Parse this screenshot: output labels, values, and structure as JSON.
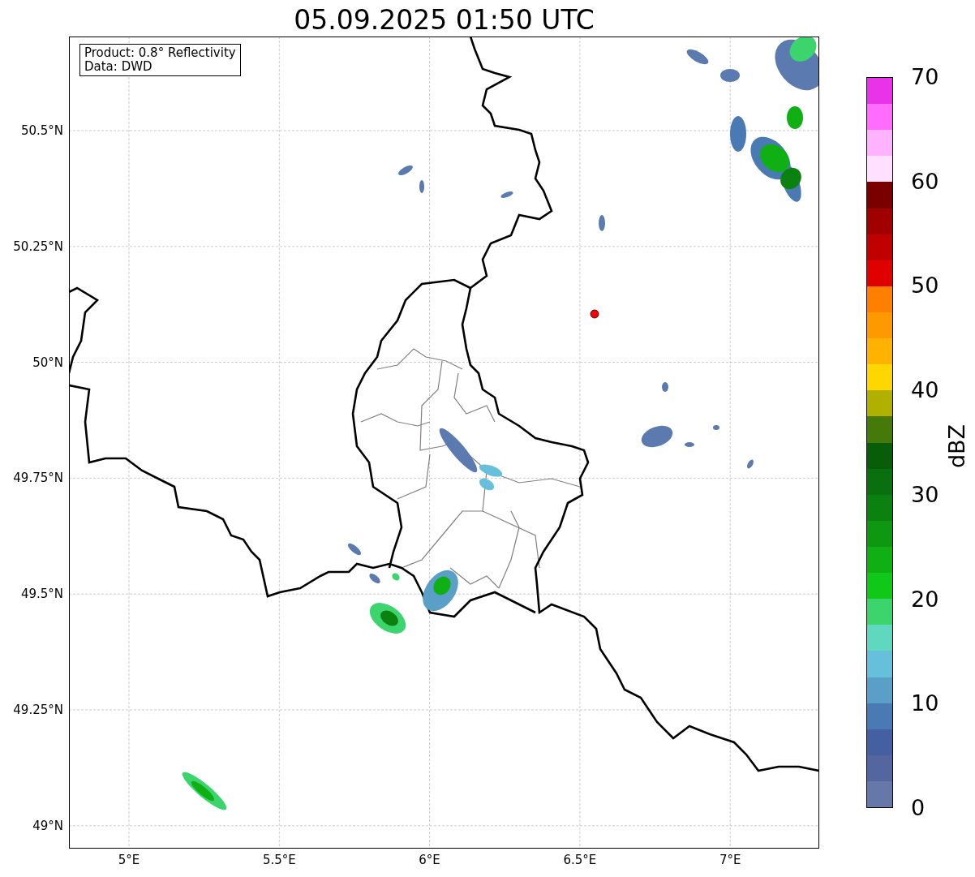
{
  "title": "05.09.2025 01:50 UTC",
  "info_box": [
    "Product: 0.8° Reflectivity",
    "Data: DWD"
  ],
  "map": {
    "lat_labels": [
      "50.5°N",
      "50.25°N",
      "50°N",
      "49.75°N",
      "49.5°N",
      "49.25°N",
      "49°N"
    ],
    "lon_labels": [
      "5°E",
      "5.5°E",
      "6°E",
      "6.5°E",
      "7°E"
    ]
  },
  "colorbar": {
    "label": "dBZ",
    "ticks": [
      "70",
      "60",
      "50",
      "40",
      "30",
      "20",
      "10",
      "0"
    ],
    "bins": [
      {
        "color": "#e933e9"
      },
      {
        "color": "#ff6cff"
      },
      {
        "color": "#ffb3ff"
      },
      {
        "color": "#ffe0ff"
      },
      {
        "color": "#7a0000"
      },
      {
        "color": "#a00000"
      },
      {
        "color": "#c00000"
      },
      {
        "color": "#e00000"
      },
      {
        "color": "#ff7f00"
      },
      {
        "color": "#ff9900"
      },
      {
        "color": "#ffb300"
      },
      {
        "color": "#ffd700"
      },
      {
        "color": "#b0b000"
      },
      {
        "color": "#457a0a"
      },
      {
        "color": "#085e08"
      },
      {
        "color": "#0a700f"
      },
      {
        "color": "#0b8210"
      },
      {
        "color": "#0e9812"
      },
      {
        "color": "#10b015"
      },
      {
        "color": "#10c818"
      },
      {
        "color": "#3cd46c"
      },
      {
        "color": "#60d8c0"
      },
      {
        "color": "#66c0dc"
      },
      {
        "color": "#5a9fc8"
      },
      {
        "color": "#4a7ab4"
      },
      {
        "color": "#4460a0"
      },
      {
        "color": "#5466a0"
      },
      {
        "color": "#6677aa"
      }
    ]
  }
}
